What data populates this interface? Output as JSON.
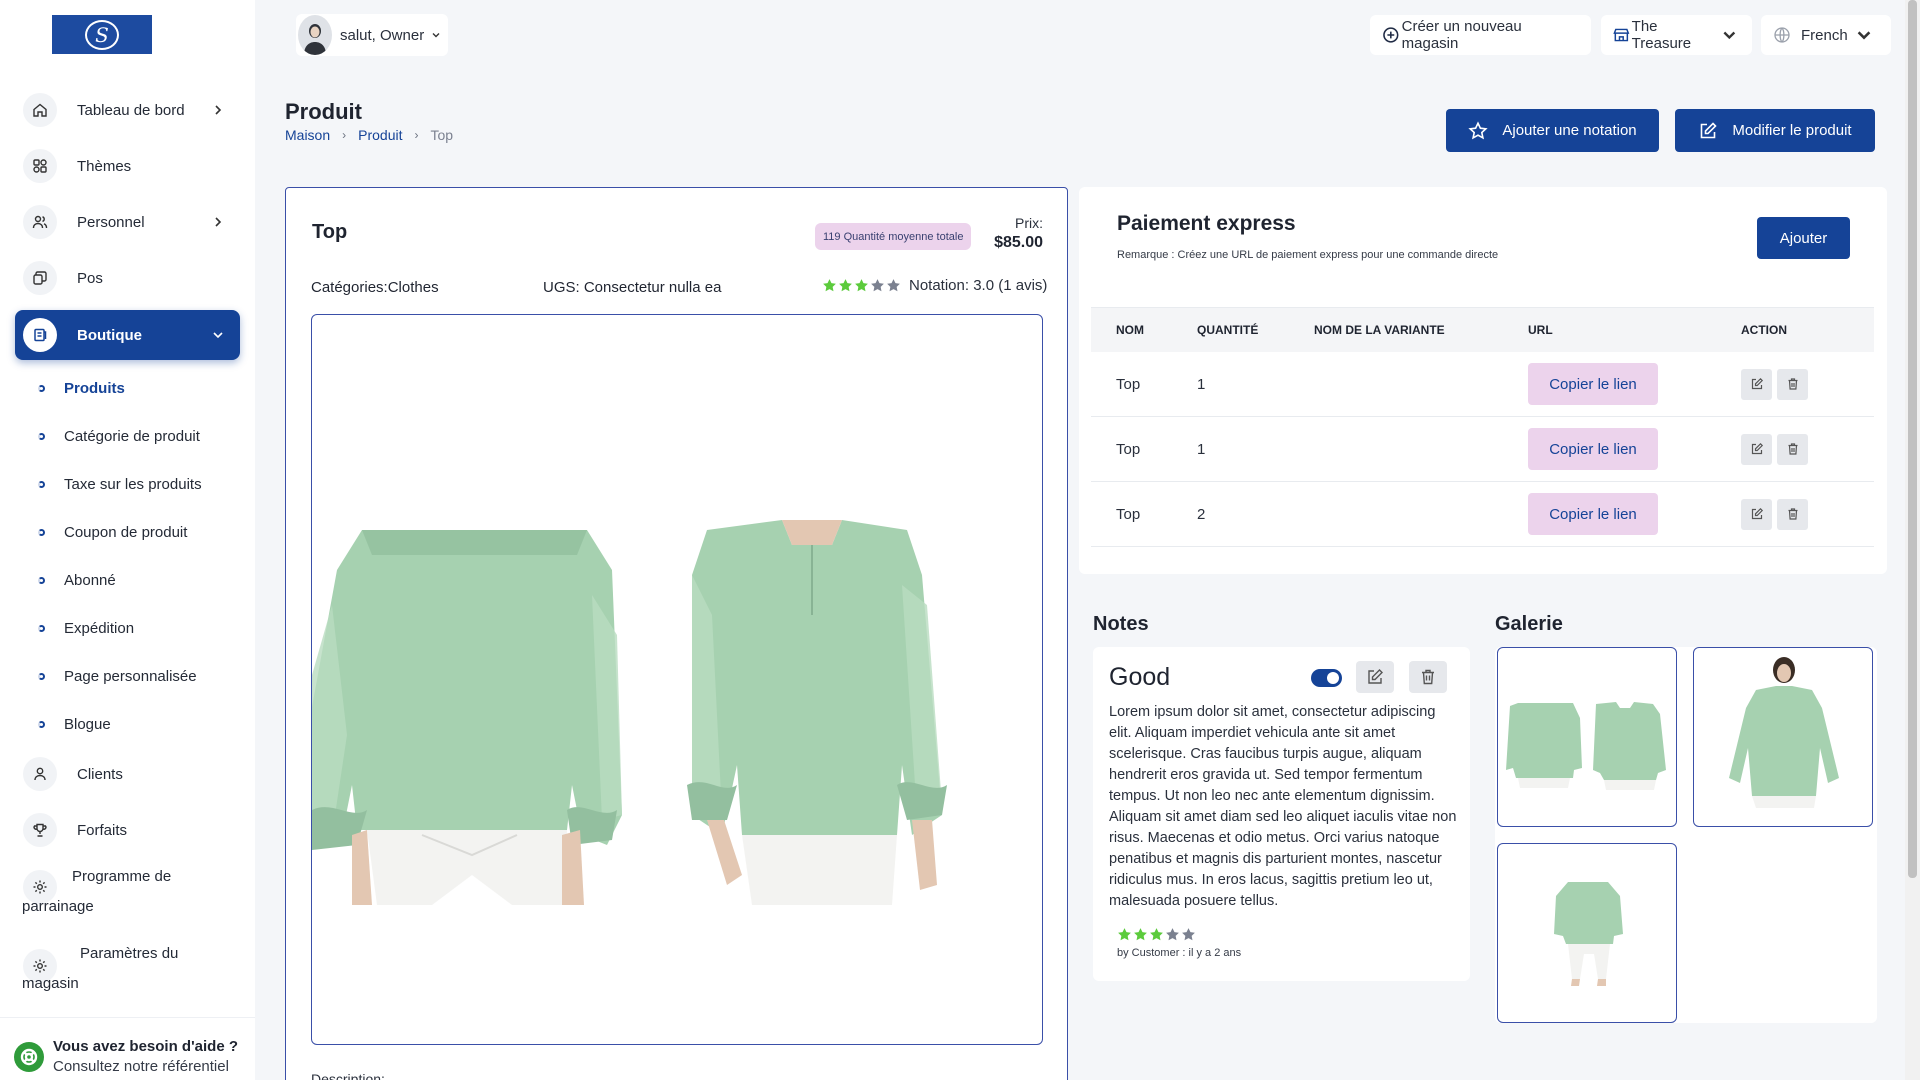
{
  "sidebar": {
    "items": [
      {
        "label": "Tableau de bord"
      },
      {
        "label": "Thèmes"
      },
      {
        "label": "Personnel"
      },
      {
        "label": "Pos"
      },
      {
        "label": "Boutique"
      },
      {
        "label": "Clients"
      },
      {
        "label": "Forfaits"
      },
      {
        "label": "Programme de parrainage"
      },
      {
        "label": "Paramètres du magasin"
      }
    ],
    "sub_items": [
      {
        "label": "Produits"
      },
      {
        "label": "Catégorie de produit"
      },
      {
        "label": "Taxe sur les produits"
      },
      {
        "label": "Coupon de produit"
      },
      {
        "label": "Abonné"
      },
      {
        "label": "Expédition"
      },
      {
        "label": "Page personnalisée"
      },
      {
        "label": "Blogue"
      }
    ],
    "help": {
      "title": "Vous avez besoin d'aide ?",
      "subtitle": "Consultez notre référentiel"
    }
  },
  "topbar": {
    "greeting": "salut, Owner",
    "create_store": "Créer un nouveau magasin",
    "store": "The Treasure",
    "language": "French"
  },
  "header": {
    "title": "Produit",
    "breadcrumb": [
      "Maison",
      "Produit",
      "Top"
    ],
    "add_rating": "Ajouter une notation",
    "edit_product": "Modifier le produit"
  },
  "product": {
    "name": "Top",
    "qty_badge": "119 Quantité moyenne totale",
    "price_label": "Prix:",
    "price": "$85.00",
    "categories": "Catégories:Clothes",
    "sku": "UGS: Consectetur nulla ea",
    "rating_text": "Notation: 3.0 (1 avis)",
    "rating": 3,
    "rating_max": 5,
    "description_label": "Description:"
  },
  "express_payment": {
    "title": "Paiement express",
    "note": "Remarque : Créez une URL de paiement express pour une commande directe",
    "add_label": "Ajouter",
    "columns": [
      "NOM",
      "QUANTITÉ",
      "NOM DE LA VARIANTE",
      "URL",
      "ACTION"
    ],
    "copy_label": "Copier le lien",
    "rows": [
      {
        "name": "Top",
        "qty": "1",
        "variant": ""
      },
      {
        "name": "Top",
        "qty": "1",
        "variant": ""
      },
      {
        "name": "Top",
        "qty": "2",
        "variant": ""
      }
    ]
  },
  "notes": {
    "title": "Notes",
    "card": {
      "title": "Good",
      "enabled": true,
      "body": "Lorem ipsum dolor sit amet, consectetur adipiscing elit. Aliquam imperdiet vehicula ante sit amet scelerisque. Cras faucibus turpis augue, aliquam hendrerit eros gravida ut. Sed tempor fermentum tempus. Ut non leo nec ante elementum dignissim. Aliquam sit amet diam sed leo aliquet iaculis vitae non risus. Maecenas et odio metus. Orci varius natoque penatibus et magnis dis parturient montes, nascetur ridiculus mus. In eros lacus, sagittis pretium leo ut, malesuada posuere tellus.",
      "rating": 3,
      "by": "by Customer : il y a 2 ans"
    }
  },
  "gallery": {
    "title": "Galerie"
  },
  "colors": {
    "primary": "#154397",
    "badge": "#ecd3ec",
    "star": "#5ccb3c",
    "star_empty": "#7b8190",
    "shirt": "#a6d1b0"
  }
}
